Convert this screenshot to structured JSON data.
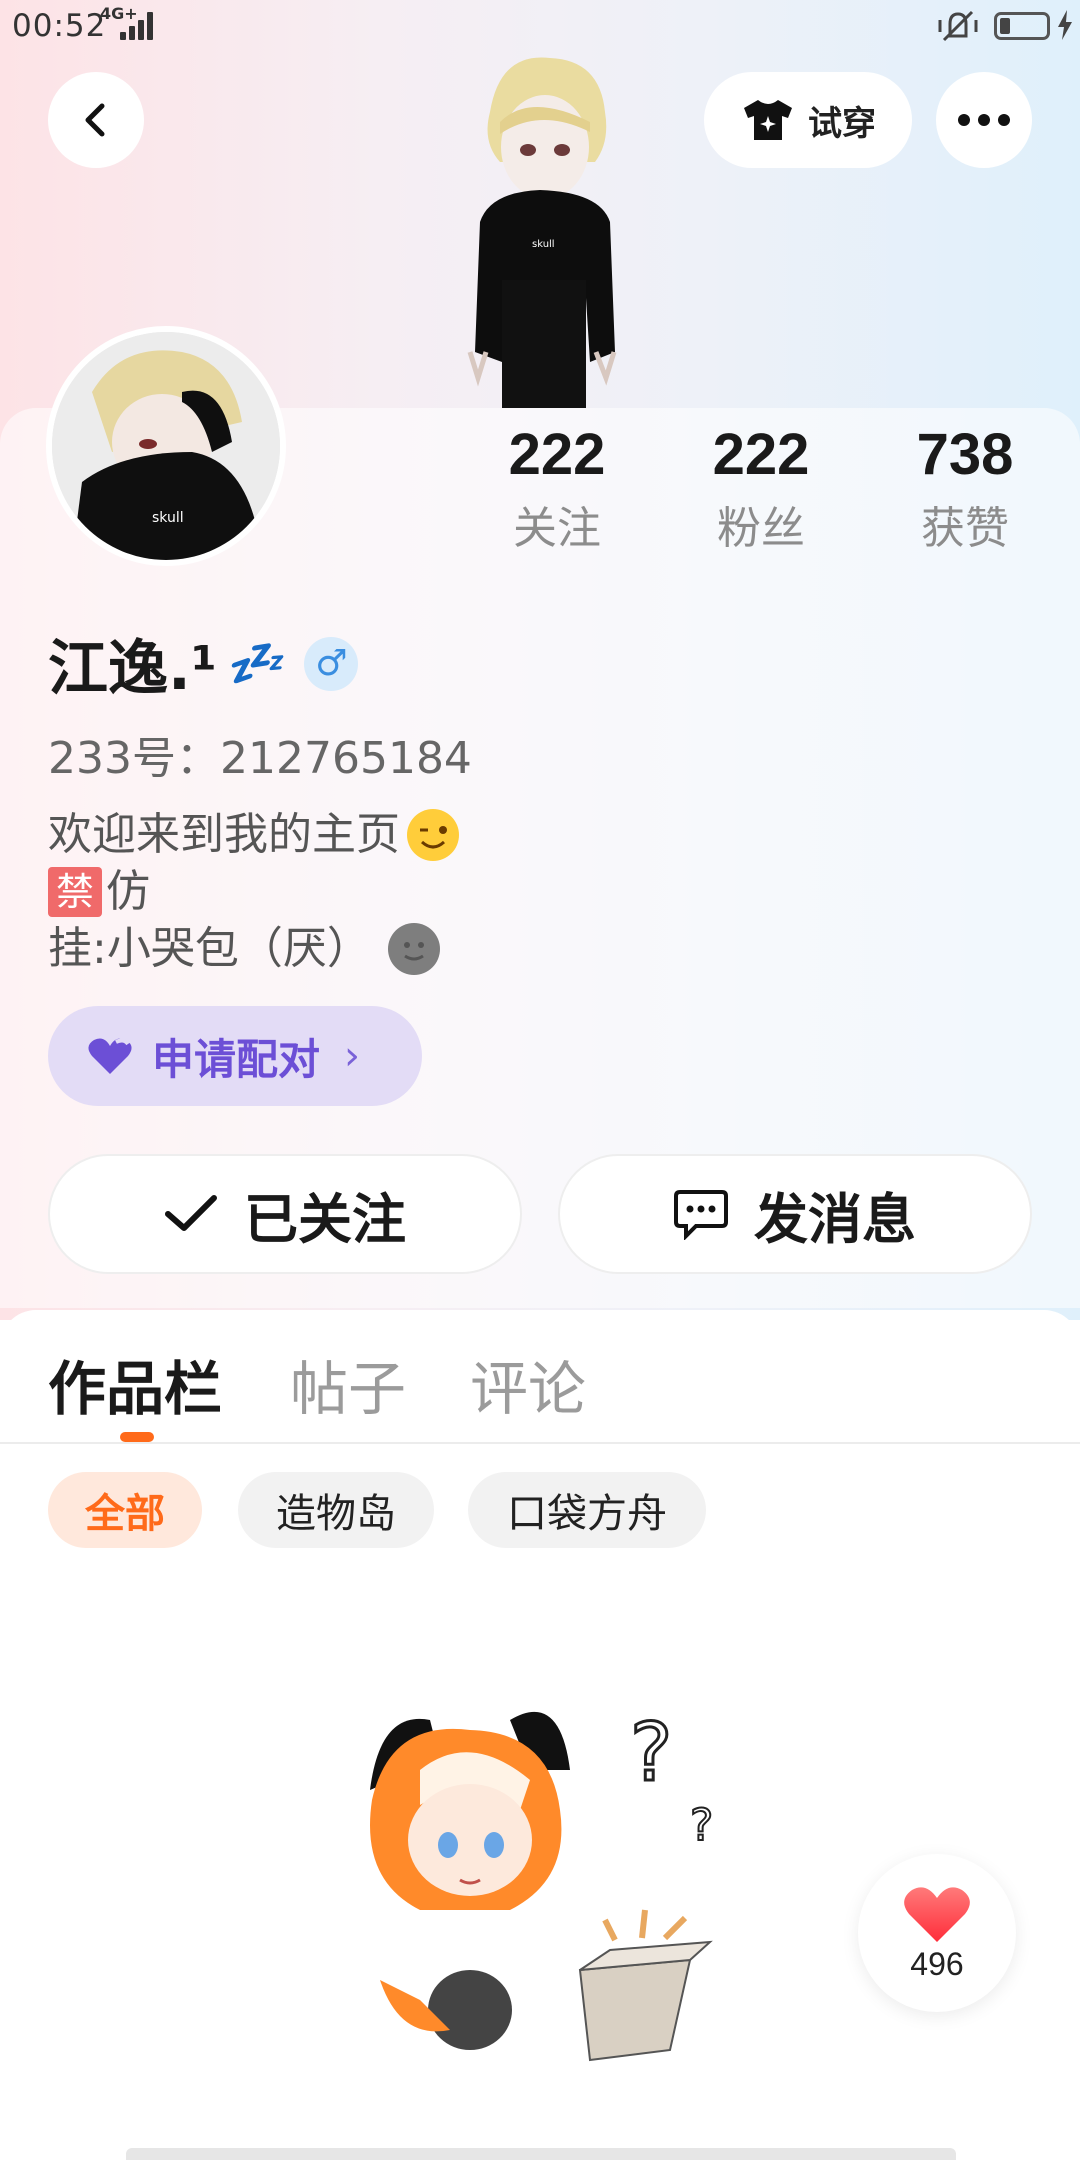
{
  "status_bar": {
    "time": "00:52",
    "network": "4G+"
  },
  "header": {
    "try_on_label": "试穿"
  },
  "profile": {
    "stats": [
      {
        "value": "222",
        "label": "关注"
      },
      {
        "value": "222",
        "label": "粉丝"
      },
      {
        "value": "738",
        "label": "获赞"
      }
    ],
    "name": "江逸.¹",
    "zzz": "💤",
    "gender_symbol": "♂",
    "uid": "233号：212765184",
    "bio_line1": "欢迎来到我的主页",
    "bio_ban_tag": "禁",
    "bio_line2": "仿",
    "bio_line3": "挂:小哭包（厌）",
    "pair_label": "申请配对",
    "follow_label": "已关注",
    "message_label": "发消息"
  },
  "tabs": [
    {
      "label": "作品栏",
      "active": true
    },
    {
      "label": "帖子",
      "active": false
    },
    {
      "label": "评论",
      "active": false
    }
  ],
  "chips": [
    {
      "label": "全部",
      "active": true
    },
    {
      "label": "造物岛",
      "active": false
    },
    {
      "label": "口袋方舟",
      "active": false
    }
  ],
  "like_fab": {
    "count": "496"
  },
  "colors": {
    "accent_orange": "#ff6a1a",
    "pair_purple": "#6c4fd6",
    "gender_blue": "#3a8ee0"
  },
  "icons": {
    "back": "chevron-left-icon",
    "try_on": "tshirt-icon",
    "more": "more-dots-icon",
    "pair": "heart-icon",
    "follow": "check-icon",
    "message": "chat-bubble-icon",
    "like": "heart-icon"
  }
}
